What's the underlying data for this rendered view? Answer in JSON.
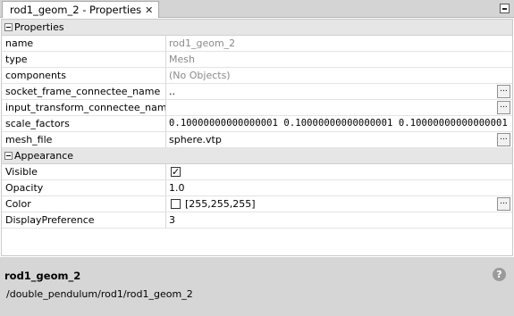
{
  "tab": {
    "title": "rod1_geom_2 - Properties",
    "close_glyph": "✕"
  },
  "sections": {
    "properties": "Properties",
    "appearance": "Appearance"
  },
  "properties": {
    "name": {
      "label": "name",
      "value": "rod1_geom_2"
    },
    "type": {
      "label": "type",
      "value": "Mesh"
    },
    "components": {
      "label": "components",
      "value": "(No Objects)"
    },
    "socket_frame": {
      "label": "socket_frame_connectee_name",
      "value": ".."
    },
    "input_transform": {
      "label": "input_transform_connectee_name",
      "value": ""
    },
    "scale_factors": {
      "label": "scale_factors",
      "value": "0.10000000000000001 0.10000000000000001 0.10000000000000001"
    },
    "mesh_file": {
      "label": "mesh_file",
      "value": "sphere.vtp"
    }
  },
  "appearance": {
    "visible": {
      "label": "Visible",
      "checked": true
    },
    "opacity": {
      "label": "Opacity",
      "value": "1.0"
    },
    "color": {
      "label": "Color",
      "value": "[255,255,255]",
      "swatch": "#ffffff"
    },
    "display_preference": {
      "label": "DisplayPreference",
      "value": "3"
    }
  },
  "browse_button_label": "...",
  "info": {
    "title": "rod1_geom_2",
    "path": "/double_pendulum/rod1/rod1_geom_2",
    "help_glyph": "?"
  }
}
